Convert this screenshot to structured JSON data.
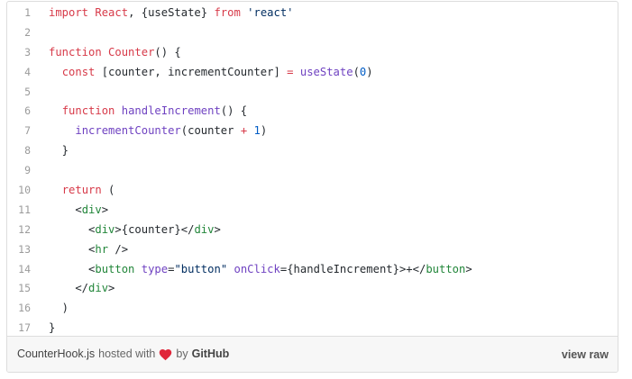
{
  "gist": {
    "lines": [
      {
        "n": "1",
        "tokens": [
          {
            "t": "import",
            "c": "kw"
          },
          {
            "t": " React",
            "c": "kw"
          },
          {
            "t": ", {useState} ",
            "c": ""
          },
          {
            "t": "from",
            "c": "kw"
          },
          {
            "t": " ",
            "c": ""
          },
          {
            "t": "'react'",
            "c": "str"
          }
        ]
      },
      {
        "n": "2",
        "tokens": []
      },
      {
        "n": "3",
        "tokens": [
          {
            "t": "function",
            "c": "kw"
          },
          {
            "t": " ",
            "c": ""
          },
          {
            "t": "Counter",
            "c": "kw"
          },
          {
            "t": "() {",
            "c": ""
          }
        ]
      },
      {
        "n": "4",
        "tokens": [
          {
            "t": "  ",
            "c": ""
          },
          {
            "t": "const",
            "c": "kw"
          },
          {
            "t": " [counter, incrementCounter] ",
            "c": ""
          },
          {
            "t": "=",
            "c": "kw"
          },
          {
            "t": " ",
            "c": ""
          },
          {
            "t": "useState",
            "c": "fn"
          },
          {
            "t": "(",
            "c": ""
          },
          {
            "t": "0",
            "c": "num-lit"
          },
          {
            "t": ")",
            "c": ""
          }
        ]
      },
      {
        "n": "5",
        "tokens": []
      },
      {
        "n": "6",
        "tokens": [
          {
            "t": "  ",
            "c": ""
          },
          {
            "t": "function",
            "c": "kw"
          },
          {
            "t": " ",
            "c": ""
          },
          {
            "t": "handleIncrement",
            "c": "fn"
          },
          {
            "t": "() {",
            "c": ""
          }
        ]
      },
      {
        "n": "7",
        "tokens": [
          {
            "t": "    ",
            "c": ""
          },
          {
            "t": "incrementCounter",
            "c": "fn"
          },
          {
            "t": "(counter ",
            "c": ""
          },
          {
            "t": "+",
            "c": "kw"
          },
          {
            "t": " ",
            "c": ""
          },
          {
            "t": "1",
            "c": "num-lit"
          },
          {
            "t": ")",
            "c": ""
          }
        ]
      },
      {
        "n": "8",
        "tokens": [
          {
            "t": "  }",
            "c": ""
          }
        ]
      },
      {
        "n": "9",
        "tokens": []
      },
      {
        "n": "10",
        "tokens": [
          {
            "t": "  ",
            "c": ""
          },
          {
            "t": "return",
            "c": "kw"
          },
          {
            "t": " (",
            "c": ""
          }
        ]
      },
      {
        "n": "11",
        "tokens": [
          {
            "t": "    ",
            "c": ""
          },
          {
            "t": "<",
            "c": ""
          },
          {
            "t": "div",
            "c": "tag"
          },
          {
            "t": ">",
            "c": ""
          }
        ]
      },
      {
        "n": "12",
        "tokens": [
          {
            "t": "      ",
            "c": ""
          },
          {
            "t": "<",
            "c": ""
          },
          {
            "t": "div",
            "c": "tag"
          },
          {
            "t": ">{counter}</",
            "c": ""
          },
          {
            "t": "div",
            "c": "tag"
          },
          {
            "t": ">",
            "c": ""
          }
        ]
      },
      {
        "n": "13",
        "tokens": [
          {
            "t": "      ",
            "c": ""
          },
          {
            "t": "<",
            "c": ""
          },
          {
            "t": "hr",
            "c": "tag"
          },
          {
            "t": " />",
            "c": ""
          }
        ]
      },
      {
        "n": "14",
        "tokens": [
          {
            "t": "      ",
            "c": ""
          },
          {
            "t": "<",
            "c": ""
          },
          {
            "t": "button",
            "c": "tag"
          },
          {
            "t": " ",
            "c": ""
          },
          {
            "t": "type",
            "c": "attr"
          },
          {
            "t": "=",
            "c": ""
          },
          {
            "t": "\"button\"",
            "c": "str"
          },
          {
            "t": " ",
            "c": ""
          },
          {
            "t": "onClick",
            "c": "attr"
          },
          {
            "t": "=",
            "c": ""
          },
          {
            "t": "{handleIncrement}",
            "c": ""
          },
          {
            "t": ">+</",
            "c": ""
          },
          {
            "t": "button",
            "c": "tag"
          },
          {
            "t": ">",
            "c": ""
          }
        ]
      },
      {
        "n": "15",
        "tokens": [
          {
            "t": "    </",
            "c": ""
          },
          {
            "t": "div",
            "c": "tag"
          },
          {
            "t": ">",
            "c": ""
          }
        ]
      },
      {
        "n": "16",
        "tokens": [
          {
            "t": "  )",
            "c": ""
          }
        ]
      },
      {
        "n": "17",
        "tokens": [
          {
            "t": "}",
            "c": ""
          }
        ]
      }
    ]
  },
  "footer": {
    "filename": "CounterHook.js",
    "hosted_with": "hosted with",
    "heart_icon": "heart-icon",
    "by": "by",
    "provider": "GitHub",
    "view_raw": "view raw",
    "heart_color": "#e0263a"
  },
  "colors": {
    "keyword": "#d73a49",
    "function": "#6f42c1",
    "string": "#032f62",
    "tag": "#22863a",
    "number": "#005cc5"
  }
}
